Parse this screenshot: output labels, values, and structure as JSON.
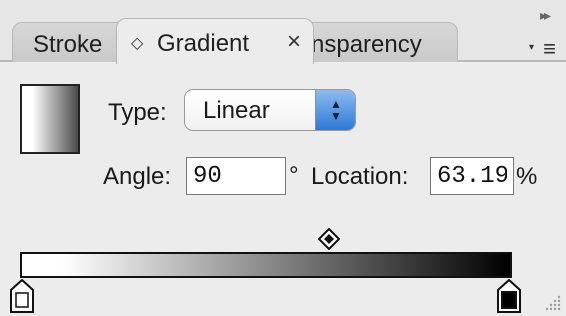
{
  "tabs": {
    "stroke": "Stroke",
    "gradient": "Gradient",
    "transparency": "nsparency",
    "gradient_icon": "◇",
    "close_icon": "×"
  },
  "controls": {
    "type_label": "Type:",
    "type_value": "Linear",
    "angle_label": "Angle:",
    "angle_value": "90",
    "degree_symbol": "°",
    "location_label": "Location:",
    "location_value": "63.19",
    "percent_symbol": "%"
  },
  "icons": {
    "collapse": "▸▸",
    "menu": "≡",
    "menu_arrow": "▾",
    "select_up": "▲",
    "select_down": "▼"
  },
  "colors": {
    "panel_bg": "#ececec",
    "select_arrow_blue": "#2f78d6",
    "gradient_start": "#ffffff",
    "gradient_end": "#000000"
  }
}
